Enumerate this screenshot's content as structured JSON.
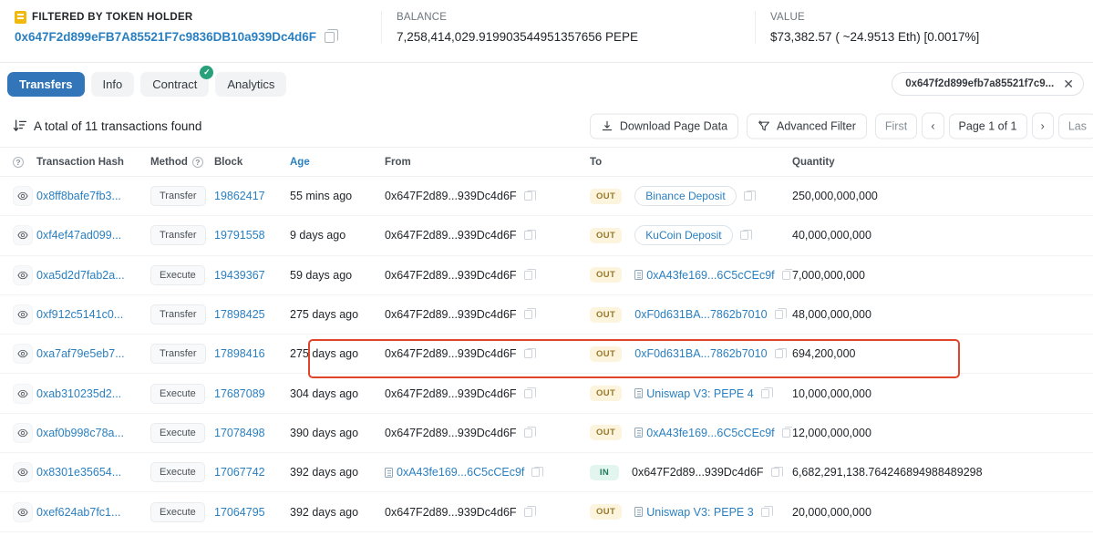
{
  "summary": {
    "filter_label": "FILTERED BY TOKEN HOLDER",
    "filter_address": "0x647F2d899eFB7A85521F7c9836DB10a939Dc4d6F",
    "balance_label": "BALANCE",
    "balance_value": "7,258,414,029.919903544951357656 PEPE",
    "value_label": "VALUE",
    "value_value": "$73,382.57 ( ~24.9513 Eth) [0.0017%]"
  },
  "tabs": [
    {
      "label": "Transfers",
      "active": true,
      "badge": ""
    },
    {
      "label": "Info",
      "active": false,
      "badge": ""
    },
    {
      "label": "Contract",
      "active": false,
      "badge": "✓"
    },
    {
      "label": "Analytics",
      "active": false,
      "badge": ""
    }
  ],
  "filter_chip": {
    "text": "0x647f2d899efb7a85521f7c9...",
    "close": "✕"
  },
  "toolbar": {
    "total_text": "A total of 11 transactions found",
    "download_label": "Download Page Data",
    "advanced_filter_label": "Advanced Filter",
    "page_first": "First",
    "page_prev": "‹",
    "page_current": "Page 1 of 1",
    "page_next": "›",
    "page_last": "Las"
  },
  "table": {
    "headers": {
      "eye": "?",
      "hash": "Transaction Hash",
      "method": "Method",
      "method_help": "?",
      "block": "Block",
      "age": "Age",
      "from": "From",
      "to": "To",
      "quantity": "Quantity"
    },
    "rows": [
      {
        "hash": "0x8ff8bafe7fb3...",
        "method": "Transfer",
        "block": "19862417",
        "age": "55 mins ago",
        "from": "0x647F2d89...939Dc4d6F",
        "from_is_contract": false,
        "direction": "OUT",
        "to": "Binance Deposit",
        "to_style": "pill",
        "to_is_contract": false,
        "quantity": "250,000,000,000"
      },
      {
        "hash": "0xf4ef47ad099...",
        "method": "Transfer",
        "block": "19791558",
        "age": "9 days ago",
        "from": "0x647F2d89...939Dc4d6F",
        "from_is_contract": false,
        "direction": "OUT",
        "to": "KuCoin Deposit",
        "to_style": "pill",
        "to_is_contract": false,
        "quantity": "40,000,000,000"
      },
      {
        "hash": "0xa5d2d7fab2a...",
        "method": "Execute",
        "block": "19439367",
        "age": "59 days ago",
        "from": "0x647F2d89...939Dc4d6F",
        "from_is_contract": false,
        "direction": "OUT",
        "to": "0xA43fe169...6C5cCEc9f",
        "to_style": "link",
        "to_is_contract": true,
        "quantity": "7,000,000,000"
      },
      {
        "hash": "0xf912c5141c0...",
        "method": "Transfer",
        "block": "17898425",
        "age": "275 days ago",
        "from": "0x647F2d89...939Dc4d6F",
        "from_is_contract": false,
        "direction": "OUT",
        "to": "0xF0d631BA...7862b7010",
        "to_style": "link",
        "to_is_contract": false,
        "quantity": "48,000,000,000"
      },
      {
        "hash": "0xa7af79e5eb7...",
        "method": "Transfer",
        "block": "17898416",
        "age": "275 days ago",
        "from": "0x647F2d89...939Dc4d6F",
        "from_is_contract": false,
        "direction": "OUT",
        "to": "0xF0d631BA...7862b7010",
        "to_style": "link",
        "to_is_contract": false,
        "quantity": "694,200,000"
      },
      {
        "hash": "0xab310235d2...",
        "method": "Execute",
        "block": "17687089",
        "age": "304 days ago",
        "from": "0x647F2d89...939Dc4d6F",
        "from_is_contract": false,
        "direction": "OUT",
        "to": "Uniswap V3: PEPE 4",
        "to_style": "link",
        "to_is_contract": true,
        "quantity": "10,000,000,000"
      },
      {
        "hash": "0xaf0b998c78a...",
        "method": "Execute",
        "block": "17078498",
        "age": "390 days ago",
        "from": "0x647F2d89...939Dc4d6F",
        "from_is_contract": false,
        "direction": "OUT",
        "to": "0xA43fe169...6C5cCEc9f",
        "to_style": "link",
        "to_is_contract": true,
        "quantity": "12,000,000,000"
      },
      {
        "hash": "0x8301e35654...",
        "method": "Execute",
        "block": "17067742",
        "age": "392 days ago",
        "from": "0xA43fe169...6C5cCEc9f",
        "from_is_contract": true,
        "direction": "IN",
        "to": "0x647F2d89...939Dc4d6F",
        "to_style": "plain",
        "to_is_contract": false,
        "quantity": "6,682,291,138.764246894988489298"
      },
      {
        "hash": "0xef624ab7fc1...",
        "method": "Execute",
        "block": "17064795",
        "age": "392 days ago",
        "from": "0x647F2d89...939Dc4d6F",
        "from_is_contract": false,
        "direction": "OUT",
        "to": "Uniswap V3: PEPE 3",
        "to_style": "link",
        "to_is_contract": true,
        "quantity": "20,000,000,000"
      }
    ]
  },
  "colors": {
    "accent": "#2a7fc0",
    "tab_active": "#3275b8",
    "out_badge_bg": "#fdf4dd",
    "out_badge_fg": "#97792a",
    "in_badge_bg": "#e2f5ee",
    "in_badge_fg": "#1d7a5c",
    "annotation": "#e0452b",
    "check_badge": "#28a07a"
  }
}
